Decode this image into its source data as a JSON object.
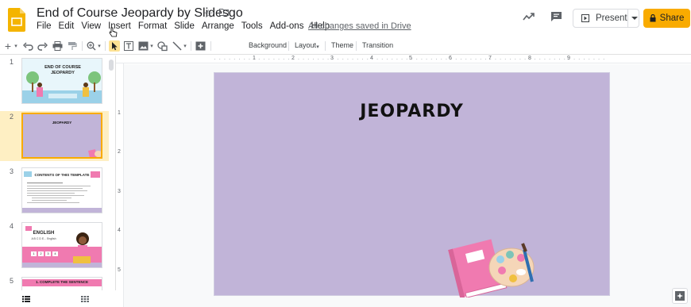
{
  "header": {
    "doc_title": "End of Course Jeopardy by Slidesgo",
    "save_status": "All changes saved in Drive",
    "menu": [
      "File",
      "Edit",
      "View",
      "Insert",
      "Format",
      "Slide",
      "Arrange",
      "Tools",
      "Add-ons",
      "Help"
    ],
    "present_label": "Present",
    "share_label": "Share",
    "icons": [
      "slides-logo-icon",
      "star-icon",
      "folder-icon",
      "activity-icon",
      "comment-icon",
      "present-icon",
      "lock-icon"
    ]
  },
  "toolbar": {
    "background_label": "Background",
    "layout_label": "Layout",
    "theme_label": "Theme",
    "transition_label": "Transition"
  },
  "filmstrip": {
    "slides": [
      {
        "number": "1",
        "title": "END OF COURSE JEOPARDY"
      },
      {
        "number": "2",
        "title": "JEOPARDY"
      },
      {
        "number": "3",
        "title": "CONTENTS OF THIS TEMPLATE"
      },
      {
        "number": "4",
        "title": "ENGLISH",
        "subtitle": "A B C D E... English",
        "tiles": [
          "1",
          "2",
          "3",
          "4"
        ]
      },
      {
        "number": "5",
        "title": "1. COMPLETE THE SENTENCE"
      }
    ]
  },
  "ruler": {
    "top": [
      "1",
      "2",
      "3",
      "4",
      "5",
      "6",
      "7",
      "8",
      "9"
    ],
    "left": [
      "1",
      "2",
      "3",
      "4",
      "5"
    ]
  },
  "slide": {
    "title": "JEOPARDY"
  },
  "colors": {
    "accent": "#f9ab00",
    "slide_bg": "#c1b4d8",
    "selected_thumb": "#feefc3",
    "thumb_pink": "#f07ab0"
  }
}
